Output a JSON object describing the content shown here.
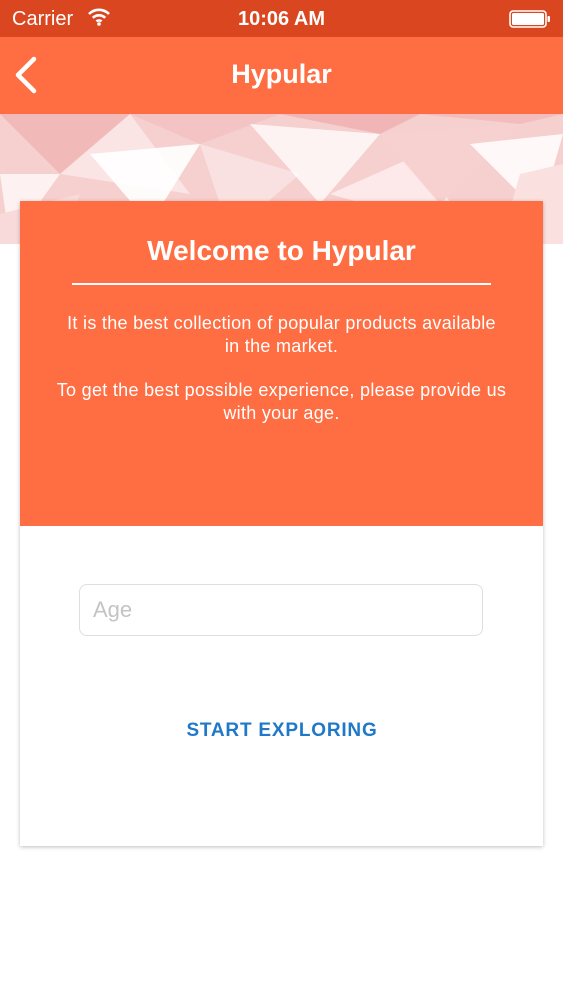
{
  "status_bar": {
    "carrier": "Carrier",
    "time": "10:06 AM",
    "wifi_icon": "wifi-icon",
    "battery_icon": "battery-icon"
  },
  "nav_bar": {
    "title": "Hypular",
    "back_icon": "chevron-left-icon"
  },
  "card": {
    "title": "Welcome to Hypular",
    "description_1": "It is the best collection of popular products available in the market.",
    "description_2": "To get the best possible experience, please provide us with your age.",
    "age_placeholder": "Age",
    "age_value": "",
    "start_button_label": "START EXPLORING"
  },
  "colors": {
    "status_bar": "#d9461f",
    "primary": "#ff6d42",
    "button_text": "#1f78c8",
    "background": "#ffffff"
  }
}
